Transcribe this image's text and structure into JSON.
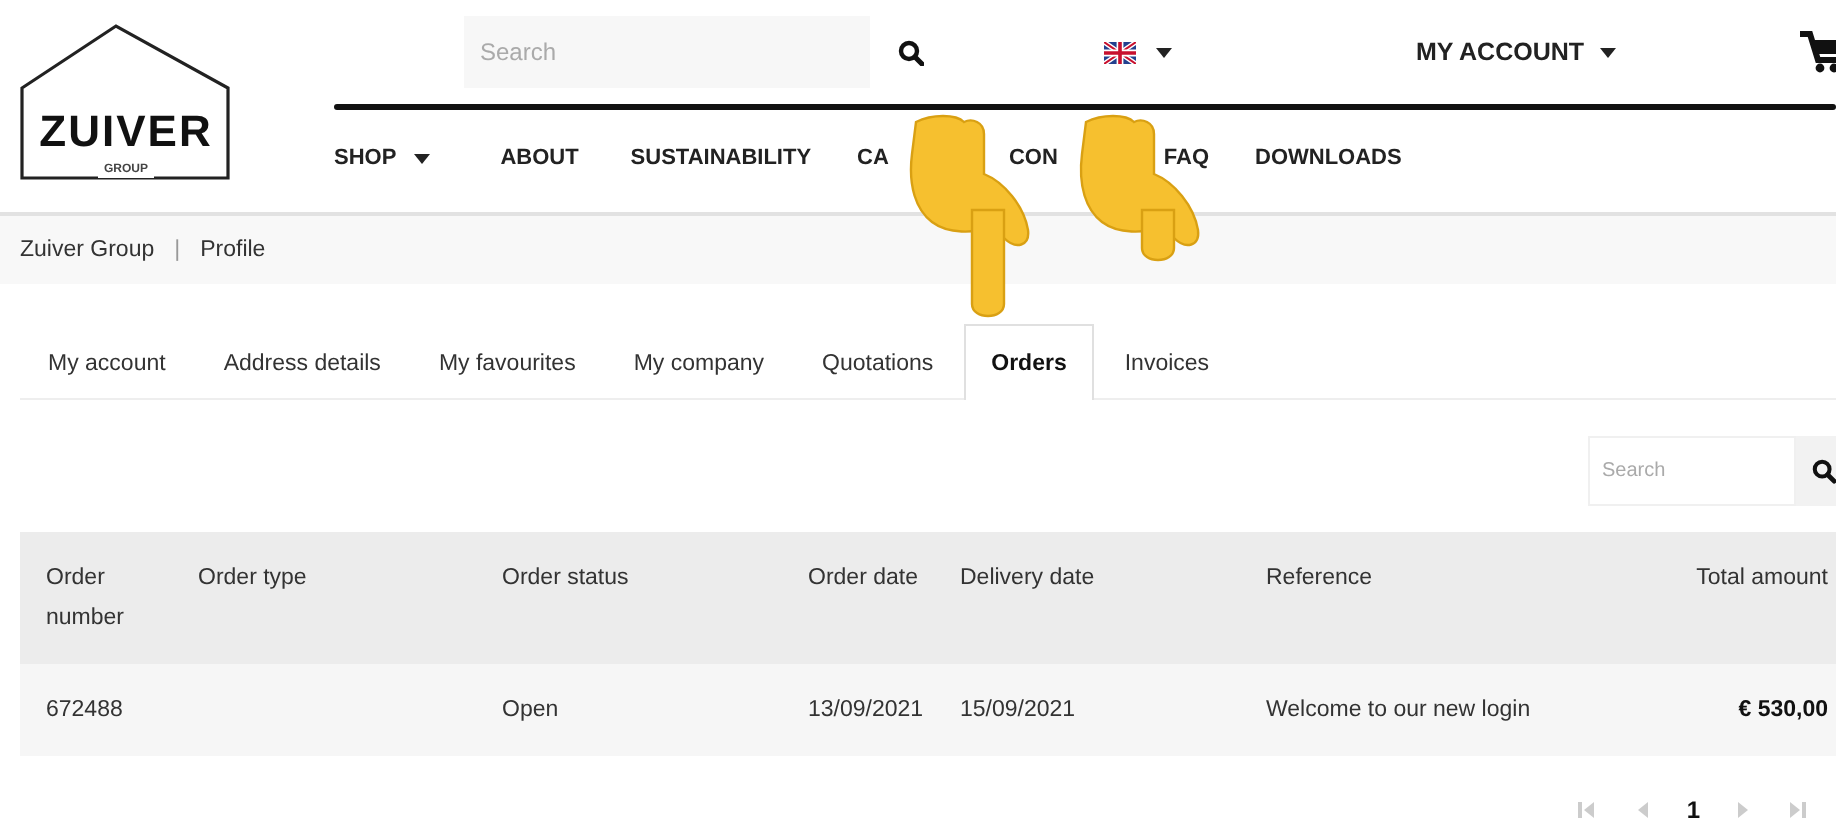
{
  "header": {
    "logo": {
      "name": "ZUIVER",
      "sub": "GROUP"
    },
    "search": {
      "placeholder": "Search"
    },
    "account_menu": "MY ACCOUNT"
  },
  "nav": [
    {
      "label": "SHOP",
      "dropdown": true
    },
    {
      "label": "ABOUT",
      "dropdown": false
    },
    {
      "label": "SUSTAINABILITY",
      "dropdown": false
    },
    {
      "label": "CA",
      "dropdown": false
    },
    {
      "label": "CON",
      "dropdown": false
    },
    {
      "label": "FAQ",
      "dropdown": false
    },
    {
      "label": "DOWNLOADS",
      "dropdown": false
    }
  ],
  "breadcrumb": {
    "items": [
      "Zuiver Group",
      "Profile"
    ],
    "separator": "|"
  },
  "tabs": [
    {
      "label": "My account",
      "selected": false
    },
    {
      "label": "Address details",
      "selected": false
    },
    {
      "label": "My favourites",
      "selected": false
    },
    {
      "label": "My company",
      "selected": false
    },
    {
      "label": "Quotations",
      "selected": false
    },
    {
      "label": "Orders",
      "selected": true
    },
    {
      "label": "Invoices",
      "selected": false
    }
  ],
  "table_search": {
    "placeholder": "Search"
  },
  "table": {
    "columns": [
      "Order number",
      "Order type",
      "Order status",
      "Order date",
      "Delivery date",
      "Reference",
      "Total amount"
    ],
    "rows": [
      [
        "672488",
        "",
        "Open",
        "13/09/2021",
        "15/09/2021",
        "Welcome to our new login",
        "€ 530,00"
      ]
    ]
  },
  "pagination": {
    "pages": [
      {
        "label": "1",
        "selected": true
      }
    ]
  }
}
